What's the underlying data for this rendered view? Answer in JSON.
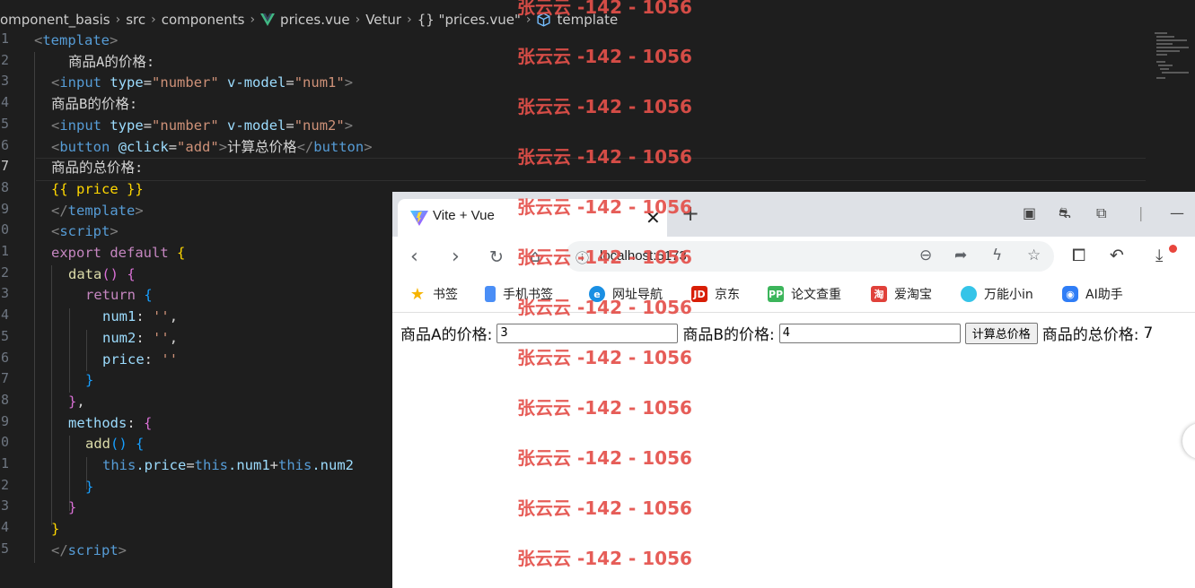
{
  "editor": {
    "breadcrumb": {
      "items": [
        "omponent_basis",
        "src",
        "components",
        "prices.vue",
        "Vetur",
        "{} \"prices.vue\"",
        "template"
      ]
    },
    "line_numbers": [
      "1",
      "2",
      "3",
      "4",
      "5",
      "6",
      "7",
      "8",
      "9",
      "0",
      "1",
      "2",
      "3",
      "4",
      "5",
      "6",
      "7",
      "8",
      "9",
      "0",
      "1",
      "2",
      "3",
      "4",
      "5"
    ],
    "active_line_number": "7",
    "code": {
      "l1_open": "<",
      "l1_tag": "template",
      "l1_close": ">",
      "l2_text": "商品A的价格:",
      "l3_open": "<",
      "l3_tag": "input",
      "l3_attr1": "type",
      "l3_eq1": "=",
      "l3_val1": "\"number\"",
      "l3_attr2": "v-model",
      "l3_eq2": "=",
      "l3_val2": "\"num1\"",
      "l3_close": ">",
      "l4_text": "商品B的价格:",
      "l5_open": "<",
      "l5_tag": "input",
      "l5_attr1": "type",
      "l5_eq1": "=",
      "l5_val1": "\"number\"",
      "l5_attr2": "v-model",
      "l5_eq2": "=",
      "l5_val2": "\"num2\"",
      "l5_close": ">",
      "l6_open": "<",
      "l6_tag": "button",
      "l6_attr": "@click",
      "l6_eq": "=",
      "l6_val": "\"add\"",
      "l6_close": ">",
      "l6_text": "计算总价格",
      "l6_end_open": "</",
      "l6_end_tag": "button",
      "l6_end_close": ">",
      "l7_text": "商品的总价格:",
      "l8_text": "{{ price }}",
      "l9_open": "</",
      "l9_tag": "template",
      "l9_close": ">",
      "l10_open": "<",
      "l10_tag": "script",
      "l10_close": ">",
      "l11_kw": "export default",
      "l11_brace": "{",
      "l12_fn": "data",
      "l12_parens": "()",
      "l12_brace": "{",
      "l13_kw": "return",
      "l13_brace": "{",
      "l14_prop": "num1",
      "l14_colon": ":",
      "l14_str": "''",
      "l14_comma": ",",
      "l15_prop": "num2",
      "l15_colon": ":",
      "l15_str": "''",
      "l15_comma": ",",
      "l16_prop": "price",
      "l16_colon": ":",
      "l16_str": "''",
      "l17_brace": "}",
      "l18_brace": "}",
      "l18_comma": ",",
      "l19_prop": "methods",
      "l19_colon": ":",
      "l19_brace": "{",
      "l20_fn": "add",
      "l20_parens": "()",
      "l20_brace": "{",
      "l21_this1": "this",
      "l21_price": ".price",
      "l21_eq": "=",
      "l21_this2": "this",
      "l21_num1": ".num1",
      "l21_plus": "+",
      "l21_this3": "this",
      "l21_num2": ".num2",
      "l22_brace": "}",
      "l23_brace": "}",
      "l24_brace": "}",
      "l25_open": "</",
      "l25_tag": "script",
      "l25_close": ">"
    }
  },
  "watermark": {
    "text": "张云云 -142 - 1056",
    "color": "#e4504a"
  },
  "browser": {
    "tab_title": "Vite + Vue",
    "tab_close": "✕",
    "new_tab": "+",
    "url": "localhost:5173",
    "bookmarks": [
      {
        "label": "书签",
        "icon": "star-icon"
      },
      {
        "label": "手机书签",
        "icon": "phone-icon"
      },
      {
        "label": "网址导航",
        "icon": "edge-icon"
      },
      {
        "label": "京东",
        "icon": "jd-icon",
        "badge": "JD"
      },
      {
        "label": "论文查重",
        "icon": "pp-icon",
        "badge": "PP"
      },
      {
        "label": "爱淘宝",
        "icon": "taobao-icon",
        "badge": "淘"
      },
      {
        "label": "万能小in",
        "icon": "xiaoin-icon"
      },
      {
        "label": "AI助手",
        "icon": "ai-icon"
      }
    ],
    "app": {
      "label_a": "商品A的价格:",
      "value_a": "3",
      "label_b": "商品B的价格:",
      "value_b": "4",
      "button_label": "计算总价格",
      "total_label": "商品的总价格:",
      "total_value": "7"
    }
  }
}
